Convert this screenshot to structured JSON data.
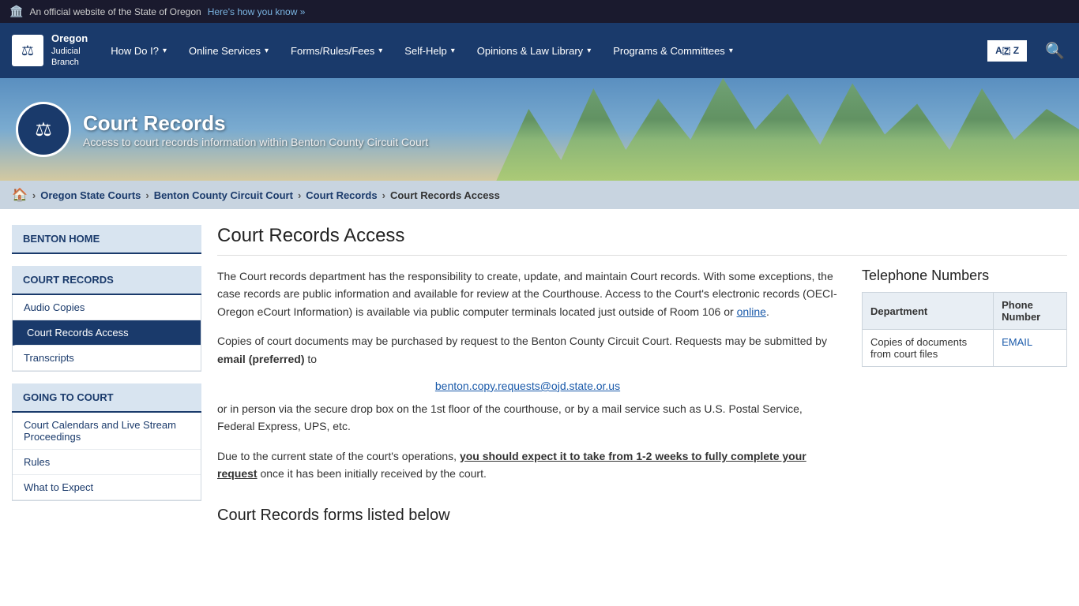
{
  "topBanner": {
    "flag": "🏛️",
    "text": "An official website of the State of Oregon",
    "linkText": "Here's how you know »"
  },
  "navbar": {
    "brand": {
      "orgLine1": "Oregon",
      "orgLine2": "Judicial",
      "orgLine3": "Branch"
    },
    "navItems": [
      {
        "label": "How Do I?",
        "hasDropdown": true
      },
      {
        "label": "Online Services",
        "hasDropdown": true
      },
      {
        "label": "Forms/Rules/Fees",
        "hasDropdown": true
      },
      {
        "label": "Self-Help",
        "hasDropdown": true
      },
      {
        "label": "Opinions & Law Library",
        "hasDropdown": true
      },
      {
        "label": "Programs & Committees",
        "hasDropdown": true
      }
    ],
    "translateLabel": "A️ Z",
    "searchLabel": "🔍"
  },
  "hero": {
    "title": "Court Records",
    "subtitle": "Access to court records information within Benton County Circuit Court"
  },
  "breadcrumb": {
    "homeLabel": "🏠",
    "items": [
      {
        "label": "Oregon State Courts",
        "href": "#"
      },
      {
        "label": "Benton County Circuit Court",
        "href": "#"
      },
      {
        "label": "Court Records",
        "href": "#"
      },
      {
        "label": "Court Records Access",
        "current": true
      }
    ]
  },
  "pageTitle": "Court Records Access",
  "sidebar": {
    "sections": [
      {
        "header": "BENTON HOME",
        "links": []
      },
      {
        "header": "COURT RECORDS",
        "links": [
          {
            "label": "Audio Copies",
            "active": false
          },
          {
            "label": "Court Records Access",
            "active": true
          },
          {
            "label": "Transcripts",
            "active": false
          }
        ]
      },
      {
        "header": "GOING TO COURT",
        "links": [
          {
            "label": "Court Calendars and Live Stream Proceedings",
            "active": false
          },
          {
            "label": "Rules",
            "active": false
          },
          {
            "label": "What to Expect",
            "active": false
          }
        ]
      }
    ]
  },
  "mainContent": {
    "para1": "The Court records department has the responsibility to create, update, and maintain Court records.  With some exceptions, the case records are public information and available for review at the Courthouse.   Access to the Court's electronic records (OECI-Oregon eCourt Information) is available via public computer terminals located just outside of Room 106 or ",
    "para1Link": "online",
    "para1LinkHref": "#",
    "para2": "Copies of court documents may be purchased by request to the Benton County Circuit Court.  Requests may be submitted by ",
    "para2Bold": "email (preferred)",
    "para2End": " to",
    "emailAddress": "benton.copy.requests@ojd.state.or.us",
    "para3": "or in person via the secure drop box on the 1st floor of the courthouse, or by a mail service such as U.S. Postal Service, Federal Express, UPS, etc.",
    "para4Start": "Due to the current state of the court's operations, ",
    "para4Bold": "you should expect it to take from 1-2 weeks to fully complete your request",
    "para4End": " once it has been initially received by the court.",
    "formsSectionTitle": "Court Records forms listed below"
  },
  "rightPanel": {
    "title": "Telephone Numbers",
    "tableHeaders": [
      "Department",
      "Phone Number"
    ],
    "tableRows": [
      {
        "department": "Copies of documents from court files",
        "phoneNumber": "EMAIL",
        "phoneHref": "#"
      }
    ]
  }
}
